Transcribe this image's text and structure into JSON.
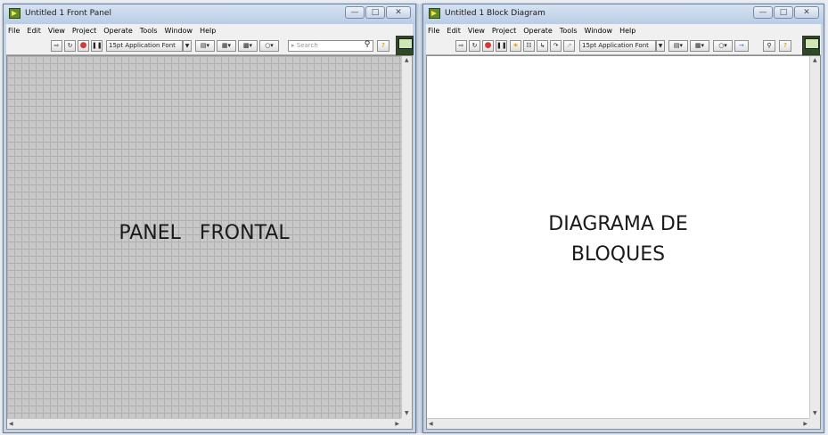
{
  "front_panel": {
    "title": "Untitled 1 Front Panel",
    "menu": [
      "File",
      "Edit",
      "View",
      "Project",
      "Operate",
      "Tools",
      "Window",
      "Help"
    ],
    "toolbar": {
      "font_label": "15pt Application Font",
      "search_placeholder": "Search"
    },
    "content_label": "PANEL   FRONTAL"
  },
  "block_diagram": {
    "title": "Untitled 1 Block Diagram",
    "menu": [
      "File",
      "Edit",
      "View",
      "Project",
      "Operate",
      "Tools",
      "Window",
      "Help"
    ],
    "toolbar": {
      "font_label": "15pt Application Font"
    },
    "content_label": "DIAGRAMA DE\nBLOQUES"
  },
  "icons": {
    "run": "run-arrow-icon",
    "run_continuous": "run-continuously-icon",
    "abort": "abort-icon",
    "pause": "pause-icon",
    "search": "search-icon",
    "help": "help-icon"
  },
  "colors": {
    "abort_red": "#d23a3a",
    "grid_bg": "#c8c8c8",
    "diagram_bg": "#ffffff",
    "title_bar": "#c4d3e5"
  }
}
